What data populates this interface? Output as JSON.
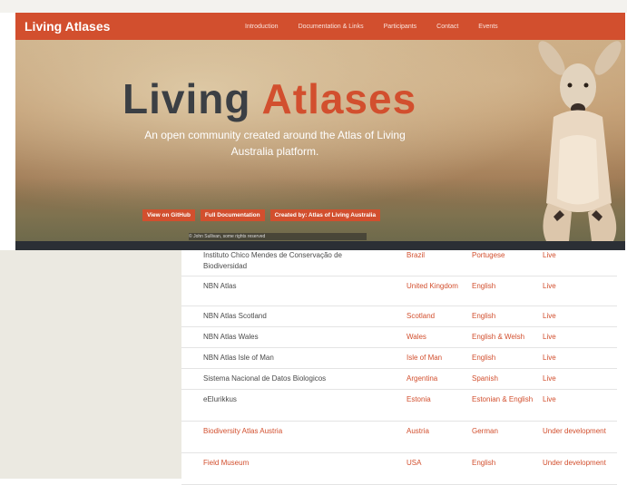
{
  "site": {
    "brand": "Living Atlases",
    "nav": [
      "Introduction",
      "Documentation & Links",
      "Participants",
      "Contact",
      "Events"
    ]
  },
  "hero": {
    "title_part1": "Living",
    "title_part2": "Atlases",
    "subtitle": "An open community created around the Atlas of Living Australia platform.",
    "buttons": [
      "View on GitHub",
      "Full Documentation",
      "Created by: Atlas of Living Australia"
    ],
    "photo_credit": "© John Sullivan, some rights reserved"
  },
  "table": {
    "rows": [
      {
        "name": "Instituto Chico Mendes de Conservação de Biodiversidad",
        "country": "Brazil",
        "language": "Portugese",
        "status": "Live",
        "name_link": false
      },
      {
        "name": "NBN Atlas",
        "country": "United Kingdom",
        "language": "English",
        "status": "Live",
        "name_link": false
      },
      {
        "name": "NBN Atlas Scotland",
        "country": "Scotland",
        "language": "English",
        "status": "Live",
        "name_link": false
      },
      {
        "name": "NBN Atlas Wales",
        "country": "Wales",
        "language": "English & Welsh",
        "status": "Live",
        "name_link": false
      },
      {
        "name": "NBN Atlas Isle of Man",
        "country": "Isle of Man",
        "language": "English",
        "status": "Live",
        "name_link": false
      },
      {
        "name": "Sistema Nacional de Datos Biologicos",
        "country": "Argentina",
        "language": "Spanish",
        "status": "Live",
        "name_link": false
      },
      {
        "name": "eElurikkus",
        "country": "Estonia",
        "language": "Estonian & English",
        "status": "Live",
        "name_link": false
      },
      {
        "name": "Biodiversity Atlas Austria",
        "country": "Austria",
        "language": "German",
        "status": "Under development",
        "name_link": true
      },
      {
        "name": "Field Museum",
        "country": "USA",
        "language": "English",
        "status": "Under development",
        "name_link": true
      }
    ]
  },
  "colors": {
    "accent": "#d24f2e",
    "dark": "#2b2f35"
  }
}
